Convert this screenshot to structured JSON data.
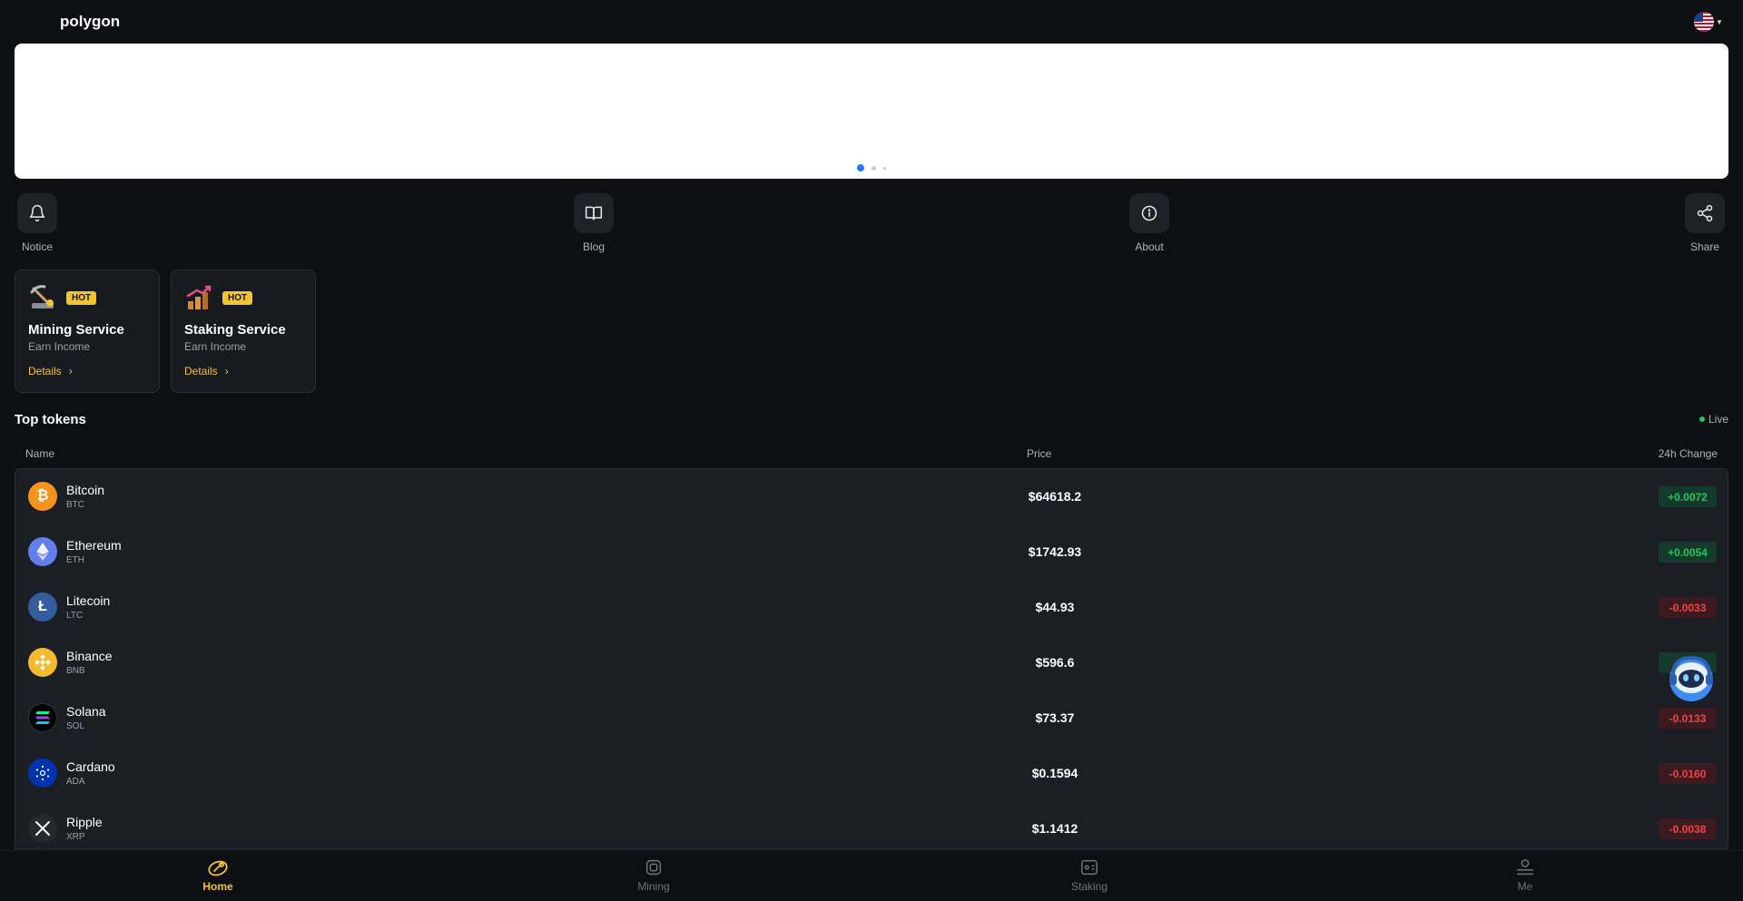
{
  "header": {
    "brand": "polygon",
    "language_icon": "us-flag-icon"
  },
  "banner": {
    "pages": 3,
    "active_page": 1
  },
  "quick_actions": [
    {
      "label": "Notice",
      "icon": "bell-icon"
    },
    {
      "label": "Blog",
      "icon": "book-icon"
    },
    {
      "label": "About",
      "icon": "info-icon"
    },
    {
      "label": "Share",
      "icon": "share-icon"
    }
  ],
  "services": [
    {
      "title": "Mining Service",
      "badge": "HOT",
      "subtitle": "Earn Income",
      "link": "Details",
      "icon": "mining-icon"
    },
    {
      "title": "Staking Service",
      "badge": "HOT",
      "subtitle": "Earn Income",
      "link": "Details",
      "icon": "staking-icon"
    }
  ],
  "tokens": {
    "title": "Top tokens",
    "live_label": "Live",
    "columns": [
      "Name",
      "Price",
      "24h Change"
    ],
    "rows": [
      {
        "name": "Bitcoin",
        "symbol": "BTC",
        "price": "$64618.2",
        "change": "+0.0072",
        "direction": "up",
        "color": "#f7931a"
      },
      {
        "name": "Ethereum",
        "symbol": "ETH",
        "price": "$1742.93",
        "change": "+0.0054",
        "direction": "up",
        "color": "#627eea"
      },
      {
        "name": "Litecoin",
        "symbol": "LTC",
        "price": "$44.93",
        "change": "-0.0033",
        "direction": "down",
        "color": "#345d9d"
      },
      {
        "name": "Binance",
        "symbol": "BNB",
        "price": "$596.6",
        "change": "+0.0",
        "direction": "up",
        "color": "#f3ba2f"
      },
      {
        "name": "Solana",
        "symbol": "SOL",
        "price": "$73.37",
        "change": "-0.0133",
        "direction": "down",
        "color": "#000000"
      },
      {
        "name": "Cardano",
        "symbol": "ADA",
        "price": "$0.1594",
        "change": "-0.0160",
        "direction": "down",
        "color": "#0033ad"
      },
      {
        "name": "Ripple",
        "symbol": "XRP",
        "price": "$1.1412",
        "change": "-0.0038",
        "direction": "down",
        "color": "#23292f"
      }
    ]
  },
  "bottom_nav": [
    {
      "label": "Home",
      "icon": "home-icon",
      "active": true
    },
    {
      "label": "Mining",
      "icon": "chip-icon",
      "active": false
    },
    {
      "label": "Staking",
      "icon": "wallet-icon",
      "active": false
    },
    {
      "label": "Me",
      "icon": "user-icon",
      "active": false
    }
  ],
  "colors": {
    "accent": "#f4c430",
    "up": "#22c55e",
    "down": "#ef4444",
    "banner_dot": "#1e7bf5"
  }
}
